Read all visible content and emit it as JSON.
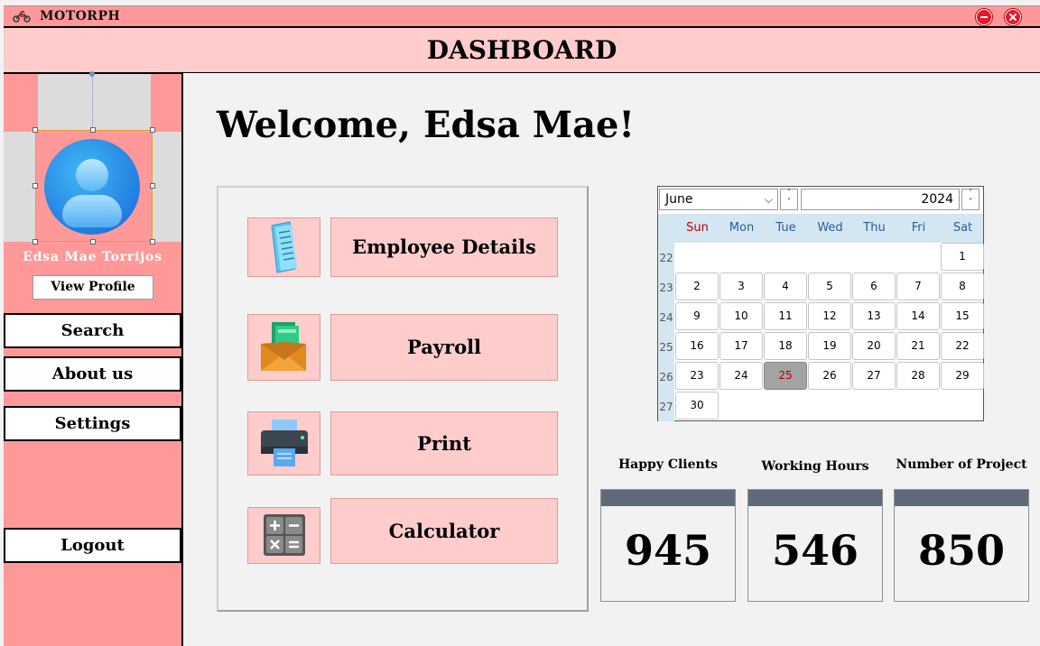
{
  "window": {
    "title": "MOTORPH"
  },
  "header": {
    "title": "DASHBOARD"
  },
  "sidebar": {
    "user_name": "Edsa Mae Torrijos",
    "view_profile": "View Profile",
    "items": [
      {
        "label": "Search"
      },
      {
        "label": "About us"
      },
      {
        "label": "Settings"
      }
    ],
    "logout": "Logout"
  },
  "main": {
    "welcome": "Welcome, Edsa Mae!",
    "menu": [
      {
        "label": "Employee Details",
        "icon": "document-icon"
      },
      {
        "label": "Payroll",
        "icon": "money-envelope-icon"
      },
      {
        "label": "Print",
        "icon": "printer-icon"
      },
      {
        "label": "Calculator",
        "icon": "calculator-icon"
      }
    ]
  },
  "calendar": {
    "month": "June",
    "year": "2024",
    "weekdays": [
      "Sun",
      "Mon",
      "Tue",
      "Wed",
      "Thu",
      "Fri",
      "Sat"
    ],
    "week_numbers": [
      "22",
      "23",
      "24",
      "25",
      "26",
      "27"
    ],
    "today": "25",
    "first_weekday_index": 6,
    "days_in_month": 30
  },
  "stats": [
    {
      "label": "Happy Clients",
      "value": "945"
    },
    {
      "label": "Working Hours",
      "value": "546"
    },
    {
      "label": "Number of Project",
      "value": "850"
    }
  ],
  "colors": {
    "sidebar": "#ff9999",
    "header": "#ffcccc",
    "button": "#ffcccc",
    "stat_bar": "#5e6b7b",
    "calendar_header": "#d4e6f1",
    "close_button": "#e8182a"
  }
}
